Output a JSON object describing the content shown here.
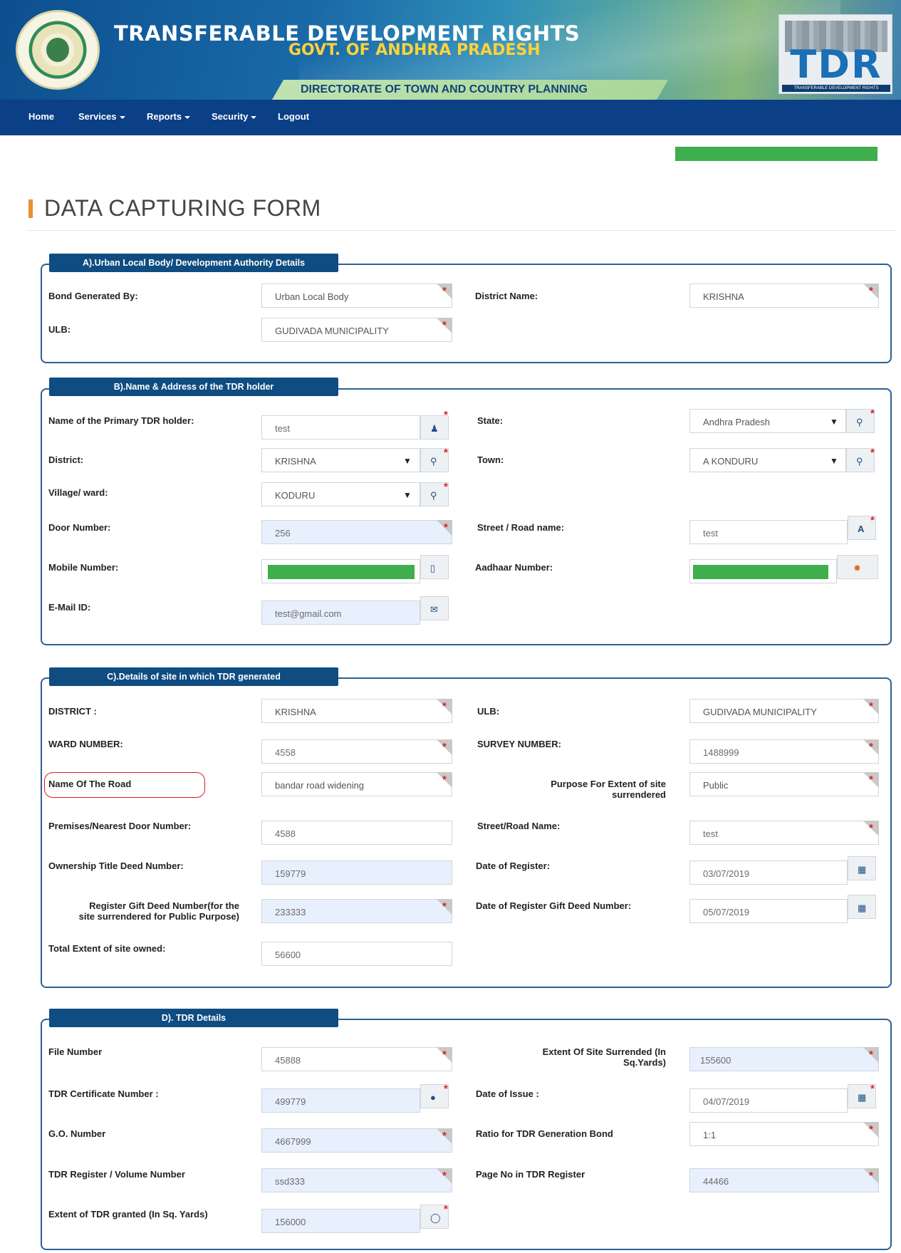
{
  "header": {
    "title": "TRANSFERABLE DEVELOPMENT RIGHTS",
    "subtitle": "GOVT. OF ANDHRA PRADESH",
    "banner": "DIRECTORATE OF TOWN AND COUNTRY PLANNING",
    "logo_text": "TDR",
    "logo_subtext": "TRANSFERABLE DEVELOPMENT RIGHTS"
  },
  "nav": {
    "home": "Home",
    "services": "Services",
    "reports": "Reports",
    "security": "Security",
    "logout": "Logout"
  },
  "page_title": "DATA CAPTURING FORM",
  "sections": {
    "a": {
      "legend": "A).Urban Local Body/ Development Authority Details",
      "bond_generated_by_label": "Bond Generated By:",
      "bond_generated_by_value": "Urban Local Body",
      "district_name_label": "District Name:",
      "district_name_value": "KRISHNA",
      "ulb_label": "ULB:",
      "ulb_value": "GUDIVADA MUNICIPALITY"
    },
    "b": {
      "legend": "B).Name & Address of the TDR holder",
      "primary_holder_label": "Name of the Primary TDR holder:",
      "primary_holder_value": "test",
      "state_label": "State:",
      "state_value": "Andhra Pradesh",
      "district_label": "District:",
      "district_value": "KRISHNA",
      "town_label": "Town:",
      "town_value": "A KONDURU",
      "village_label": "Village/ ward:",
      "village_value": "KODURU",
      "door_label": "Door Number:",
      "door_value": "256",
      "street_label": "Street / Road name:",
      "street_value": "test",
      "mobile_label": "Mobile Number:",
      "aadhaar_label": "Aadhaar Number:",
      "email_label": "E-Mail ID:",
      "email_value": "test@gmail.com"
    },
    "c": {
      "legend": "C).Details of site in which TDR generated",
      "district_label": "DISTRICT :",
      "district_value": "KRISHNA",
      "ulb_label": "ULB:",
      "ulb_value": "GUDIVADA MUNICIPALITY",
      "ward_label": "WARD NUMBER:",
      "ward_value": "4558",
      "survey_label": "SURVEY NUMBER:",
      "survey_value": "1488999",
      "road_label": "Name Of The Road",
      "road_value": "bandar road widening",
      "purpose_label_1": "Purpose For Extent of site",
      "purpose_label_2": "surrendered",
      "purpose_value": "Public",
      "premises_label": "Premises/Nearest Door Number:",
      "premises_value": "4588",
      "street_label": "Street/Road Name:",
      "street_value": "test",
      "title_deed_label": "Ownership Title Deed Number:",
      "title_deed_value": "159779",
      "date_register_label": "Date of Register:",
      "date_register_value": "03/07/2019",
      "gift_deed_label_1": "Register Gift Deed Number(for the",
      "gift_deed_label_2": "site surrendered for Public Purpose)",
      "gift_deed_value": "233333",
      "date_gift_label": "Date of Register Gift Deed Number:",
      "date_gift_value": "05/07/2019",
      "total_extent_label": "Total Extent of site owned:",
      "total_extent_value": "56600"
    },
    "d": {
      "legend": "D). TDR Details",
      "file_label": "File Number",
      "file_value": "45888",
      "extent_surr_label_1": "Extent Of Site Surrended (In",
      "extent_surr_label_2": "Sq.Yards)",
      "extent_surr_value": "155600",
      "cert_label": "TDR Certificate Number :",
      "cert_value": "499779",
      "issue_label": "Date of Issue :",
      "issue_value": "04/07/2019",
      "go_label": "G.O. Number",
      "go_value": "4667999",
      "ratio_label": "Ratio for TDR Generation Bond",
      "ratio_value": "1:1",
      "register_vol_label": "TDR Register / Volume Number",
      "register_vol_value": "ssd333",
      "page_no_label": "Page No in TDR Register",
      "page_no_value": "44466",
      "extent_granted_label": "Extent of TDR granted (In Sq. Yards)",
      "extent_granted_value": "156000"
    }
  },
  "icons": {
    "person": "user-icon",
    "marker": "map-marker-icon",
    "font": "font-icon",
    "mobile": "mobile-icon",
    "aadhaar": "aadhaar-icon",
    "envelope": "envelope-icon",
    "calendar": "calendar-icon",
    "globe": "globe-icon",
    "certificate": "certificate-icon"
  },
  "colors": {
    "navbar": "#0b3f86",
    "legend": "#0f4c81",
    "section_border": "#2d5f93",
    "accent": "#e8922e",
    "masked": "#3fae4c",
    "required": "#dd2222"
  }
}
